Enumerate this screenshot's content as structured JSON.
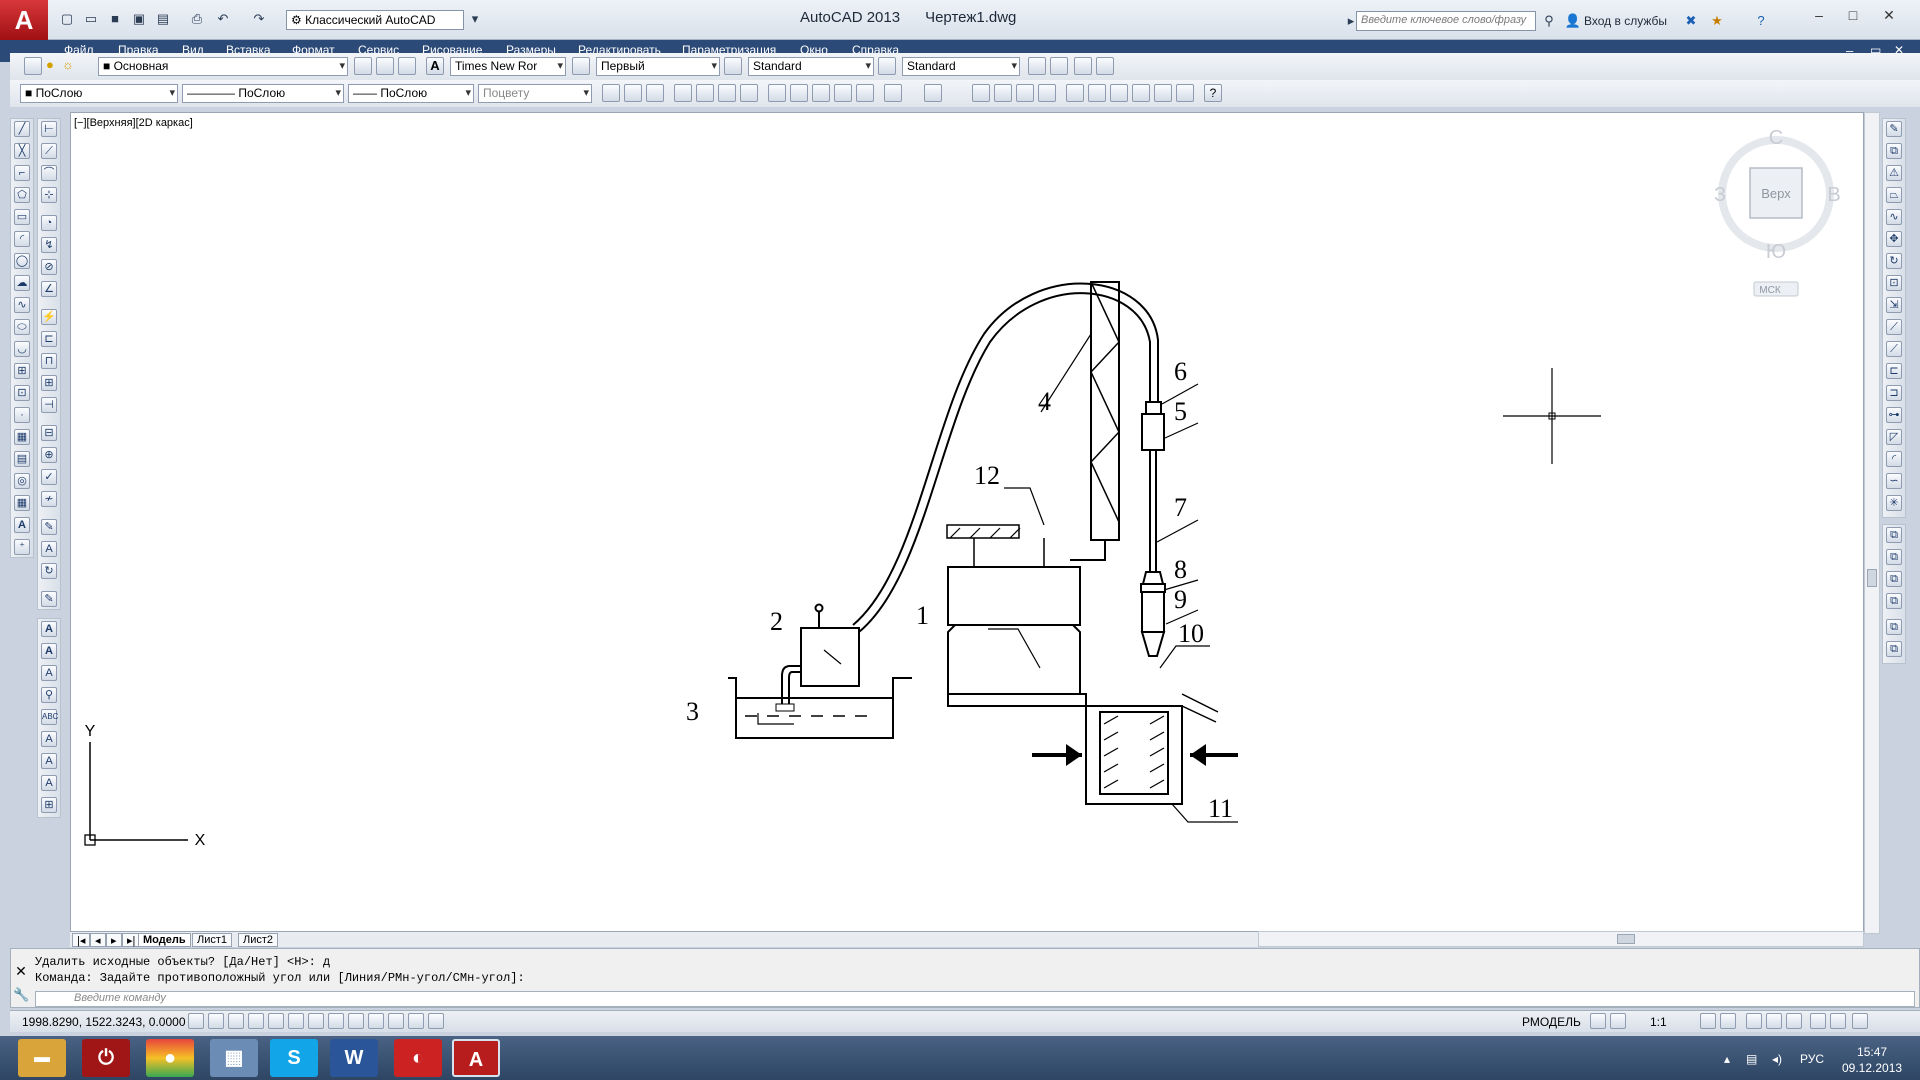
{
  "titlebar": {
    "workspace": "Классический AutoCAD",
    "app_name": "AutoCAD 2013",
    "doc_name": "Чертеж1.dwg",
    "search_placeholder": "Введите ключевое слово/фразу",
    "signin": "Вход в службы"
  },
  "menu": [
    "Файл",
    "Правка",
    "Вид",
    "Вставка",
    "Формат",
    "Сервис",
    "Рисование",
    "Размеры",
    "Редактировать",
    "Параметризация",
    "Окно",
    "Справка"
  ],
  "toolbar1": {
    "layer": "Основная",
    "text_style": "Times New Ror",
    "dim_style": "Первый",
    "table_style": "Standard",
    "mleader_style": "Standard"
  },
  "toolbar2": {
    "color": "ПоСлою",
    "linetype": "ПоСлою",
    "lineweight": "ПоСлою",
    "plotstyle": "Поцвету"
  },
  "viewport_label": "[−][Верхняя][2D каркас]",
  "viewcube": {
    "n": "С",
    "s": "Ю",
    "w": "З",
    "e": "В",
    "face": "Верх",
    "ucs": "МСК"
  },
  "ucs_icon": {
    "x": "X",
    "y": "Y"
  },
  "drawing_labels": [
    "1",
    "2",
    "3",
    "4",
    "5",
    "6",
    "7",
    "8",
    "9",
    "10",
    "11",
    "12"
  ],
  "tabs": [
    "Модель",
    "Лист1",
    "Лист2"
  ],
  "command": {
    "line1": "Удалить исходные объекты? [Да/Нет] <Н>: д",
    "line2": "Команда: Задайте противоположный угол или [Линия/РМн-угол/СМн-угол]:",
    "placeholder": "Введите команду"
  },
  "status": {
    "coords": "1998.8290, 1522.3243, 0.0000",
    "model": "РМОДЕЛЬ",
    "scale": "1:1"
  },
  "tray": {
    "lang": "РУС",
    "time": "15:47",
    "date": "09.12.2013"
  }
}
